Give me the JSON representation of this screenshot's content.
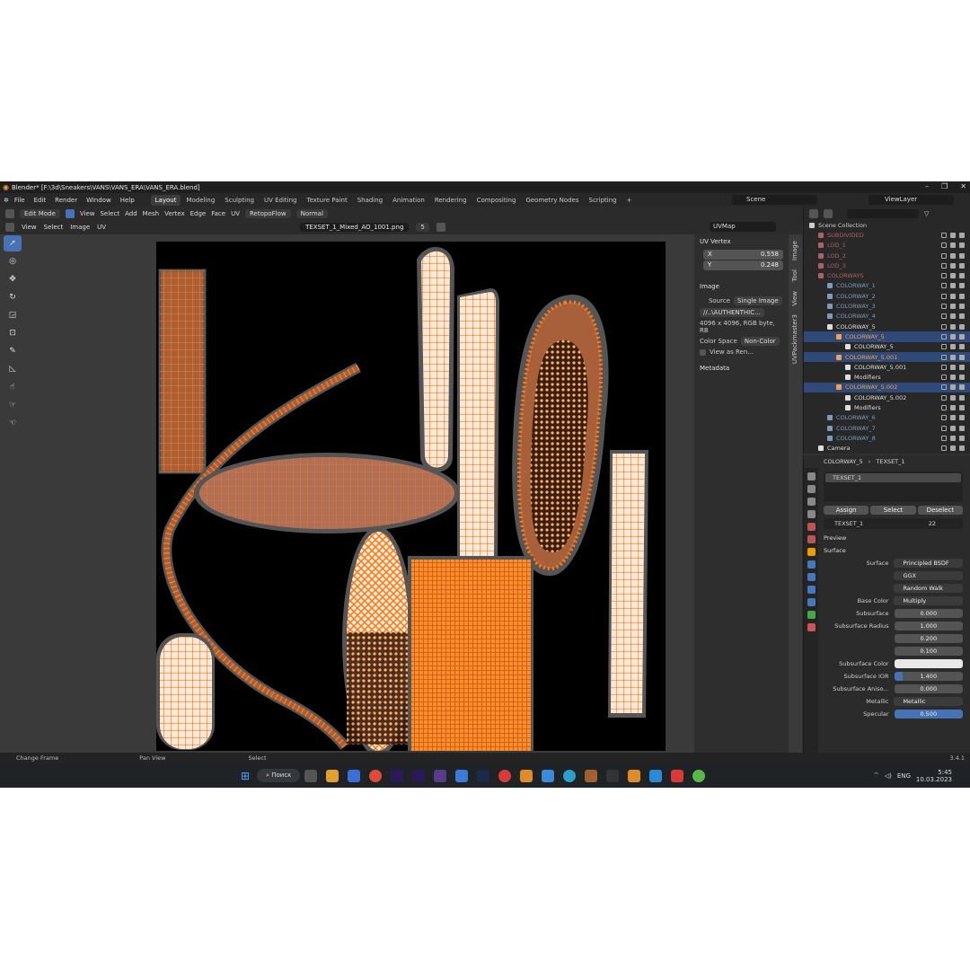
{
  "window": {
    "title": "Blender* [F:\\3d\\Sneakers\\VANS\\VANS_ERA\\VANS_ERA.blend]",
    "controls": [
      "–",
      "❐",
      "✕"
    ]
  },
  "menu": [
    "File",
    "Edit",
    "Render",
    "Window",
    "Help"
  ],
  "workspaces": [
    "Layout",
    "Modeling",
    "Sculpting",
    "UV Editing",
    "Texture Paint",
    "Shading",
    "Animation",
    "Rendering",
    "Compositing",
    "Geometry Nodes",
    "Scripting"
  ],
  "active_workspace": "Layout",
  "scene_name": "Scene",
  "view_layer": "ViewLayer",
  "tool_header": {
    "mode": "Edit Mode",
    "menus": [
      "View",
      "Select",
      "Add",
      "Mesh",
      "Vertex",
      "Edge",
      "Face",
      "UV"
    ],
    "addon": "RetopoFlow",
    "orientation": "Normal"
  },
  "uv_header": {
    "menus": [
      "View",
      "Select",
      "Image",
      "UV"
    ],
    "image_name": "TEXSET_1_Mixed_AO_1001.png",
    "users": "5",
    "uvmap": "UVMap"
  },
  "npanel": {
    "uv_vertex_title": "UV Vertex",
    "x_label": "X",
    "x_value": "0.558",
    "y_label": "Y",
    "y_value": "0.248",
    "image_title": "Image",
    "source_label": "Source",
    "source_value": "Single Image",
    "path": "//..\\AUTHENTHIC...",
    "info": "4096 x 4096,  RGB byte, RB",
    "color_space_label": "Color Space",
    "color_space_value": "Non-Color",
    "view_as_render": "View as Ren...",
    "metadata_title": "Metadata",
    "tabs": [
      "Image",
      "Tool",
      "View",
      "UVPackmaster3"
    ]
  },
  "outliner": {
    "search_placeholder": "",
    "rows": [
      {
        "label": "Scene Collection",
        "indent": 0,
        "color": "#cccccc",
        "sel": false
      },
      {
        "label": "SUBDIVIDED",
        "indent": 1,
        "color": "#b06060",
        "sel": false
      },
      {
        "label": "LOD_1",
        "indent": 1,
        "color": "#b06060",
        "sel": false
      },
      {
        "label": "LOD_2",
        "indent": 1,
        "color": "#b06060",
        "sel": false
      },
      {
        "label": "LOD_3",
        "indent": 1,
        "color": "#b06060",
        "sel": false
      },
      {
        "label": "COLORWAYS",
        "indent": 1,
        "color": "#b06060",
        "sel": false
      },
      {
        "label": "COLORWAY_1",
        "indent": 2,
        "color": "#7a9bbd",
        "sel": false
      },
      {
        "label": "COLORWAY_2",
        "indent": 2,
        "color": "#7a9bbd",
        "sel": false
      },
      {
        "label": "COLORWAY_3",
        "indent": 2,
        "color": "#7a9bbd",
        "sel": false
      },
      {
        "label": "COLORWAY_4",
        "indent": 2,
        "color": "#7a9bbd",
        "sel": false
      },
      {
        "label": "COLORWAY_5",
        "indent": 2,
        "color": "#dddddd",
        "sel": false
      },
      {
        "label": "COLORWAY_5",
        "indent": 3,
        "color": "#f0a050",
        "sel": true
      },
      {
        "label": "COLORWAY_5",
        "indent": 4,
        "color": "#dddddd",
        "sel": false
      },
      {
        "label": "COLORWAY_5.001",
        "indent": 3,
        "color": "#f0a050",
        "sel": true
      },
      {
        "label": "COLORWAY_5.001",
        "indent": 4,
        "color": "#dddddd",
        "sel": false
      },
      {
        "label": "Modifiers",
        "indent": 4,
        "color": "#dddddd",
        "sel": false
      },
      {
        "label": "COLORWAY_5.002",
        "indent": 3,
        "color": "#f0a050",
        "sel": true
      },
      {
        "label": "COLORWAY_5.002",
        "indent": 4,
        "color": "#dddddd",
        "sel": false
      },
      {
        "label": "Modifiers",
        "indent": 4,
        "color": "#dddddd",
        "sel": false
      },
      {
        "label": "COLORWAY_6",
        "indent": 2,
        "color": "#7a9bbd",
        "sel": false
      },
      {
        "label": "COLORWAY_7",
        "indent": 2,
        "color": "#7a9bbd",
        "sel": false
      },
      {
        "label": "COLORWAY_8",
        "indent": 2,
        "color": "#7a9bbd",
        "sel": false
      },
      {
        "label": "Camera",
        "indent": 1,
        "color": "#dddddd",
        "sel": false
      }
    ]
  },
  "properties": {
    "breadcrumb_object": "COLORWAY_5",
    "breadcrumb_material": "TEXSET_1",
    "slot": "TEXSET_1",
    "assign": "Assign",
    "select": "Select",
    "deselect": "Deselect",
    "material_name": "TEXSET_1",
    "material_users": "22",
    "preview": "Preview",
    "surface": "Surface",
    "rows": [
      {
        "label": "Surface",
        "value": "Principled BSDF",
        "style": "dark"
      },
      {
        "label": "",
        "value": "GGX",
        "style": "dark"
      },
      {
        "label": "",
        "value": "Random Walk",
        "style": "dark"
      },
      {
        "label": "Base Color",
        "value": "Multiply",
        "style": "dark"
      },
      {
        "label": "Subsurface",
        "value": "0.000",
        "style": "num"
      },
      {
        "label": "Subsurface Radius",
        "value": "1.000",
        "style": "num"
      },
      {
        "label": "",
        "value": "0.200",
        "style": "num"
      },
      {
        "label": "",
        "value": "0.100",
        "style": "num"
      },
      {
        "label": "Subsurface Color",
        "value": "",
        "style": "white"
      },
      {
        "label": "Subsurface IOR",
        "value": "1.400",
        "style": "blue"
      },
      {
        "label": "Subsurface Aniso...",
        "value": "0.000",
        "style": "num"
      },
      {
        "label": "Metallic",
        "value": "Metallic",
        "style": "dark"
      },
      {
        "label": "Specular",
        "value": "0.500",
        "style": "blue2"
      }
    ]
  },
  "status": {
    "left": "Change Frame",
    "mid": "Pan View",
    "right": "Select",
    "version": "3.4.1"
  },
  "taskbar": {
    "search": "Поиск",
    "lang": "ENG",
    "time": "5:45",
    "date": "10.03.2023"
  },
  "colors": {
    "accent": "#4772b3",
    "uv_orange": "#ff7a1a",
    "uv_fill": "#a8603a"
  }
}
